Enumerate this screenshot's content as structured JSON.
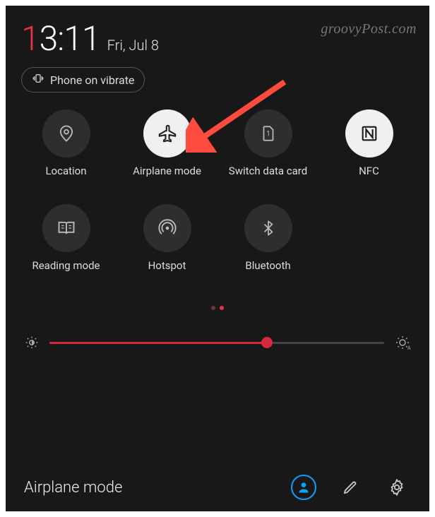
{
  "clock": {
    "hour_first": "1",
    "rest": "3:11"
  },
  "date": "Fri, Jul 8",
  "watermark": "groovyPost.com",
  "vibrate_label": "Phone on vibrate",
  "tiles": [
    {
      "label": "Location",
      "active": false,
      "icon": "location"
    },
    {
      "label": "Airplane mode",
      "active": true,
      "icon": "airplane"
    },
    {
      "label": "Switch data card",
      "active": false,
      "icon": "sim"
    },
    {
      "label": "NFC",
      "active": true,
      "icon": "nfc"
    },
    {
      "label": "Reading mode",
      "active": false,
      "icon": "book"
    },
    {
      "label": "Hotspot",
      "active": false,
      "icon": "hotspot"
    },
    {
      "label": "Bluetooth",
      "active": false,
      "icon": "bluetooth"
    }
  ],
  "pagination": {
    "total": 2,
    "current": 2
  },
  "brightness": {
    "percent": 65
  },
  "bottom": {
    "title": "Airplane mode",
    "user": "user-button",
    "edit": "edit-button",
    "settings": "settings-button"
  }
}
